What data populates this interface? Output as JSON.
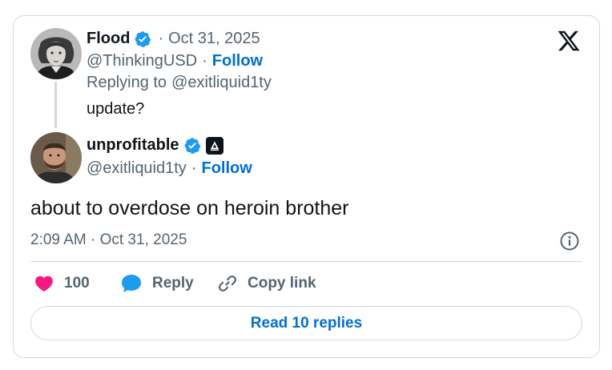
{
  "parent_tweet": {
    "author_name": "Flood",
    "separator": "·",
    "date": "Oct 31, 2025",
    "handle": "@ThinkingUSD",
    "follow_label": "Follow",
    "replying_prefix": "Replying to",
    "replying_handle": "@exitliquid1ty",
    "text": "update?"
  },
  "main_tweet": {
    "author_name": "unprofitable",
    "handle": "@exitliquid1ty",
    "separator": "·",
    "follow_label": "Follow",
    "text": "about to overdose on heroin brother",
    "timestamp": "2:09 AM · Oct 31, 2025"
  },
  "actions": {
    "like_count": "100",
    "reply_label": "Reply",
    "copy_link_label": "Copy link"
  },
  "read_replies_label": "Read 10 replies",
  "icons": {
    "brand": "x-logo-icon",
    "verified": "verified-badge-icon",
    "affiliate": "affiliate-badge-icon",
    "info": "info-icon",
    "like": "heart-icon",
    "reply": "reply-bubble-icon",
    "link": "link-icon"
  },
  "colors": {
    "link_blue": "#006fd6",
    "verified_blue": "#1d9bf0",
    "like_pink": "#f91880",
    "secondary_text": "#536471",
    "border": "#cfd9de"
  }
}
